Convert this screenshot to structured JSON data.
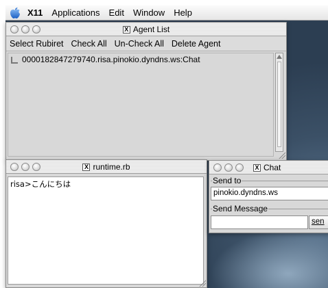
{
  "menubar": {
    "app_name": "X11",
    "items": [
      "Applications",
      "Edit",
      "Window",
      "Help"
    ]
  },
  "agent_window": {
    "title": "Agent List",
    "toolbar": [
      "Select Rubiret",
      "Check All",
      "Un-Check All",
      "Delete Agent"
    ],
    "agents": [
      "0000182847279740.risa.pinokio.dyndns.ws:Chat"
    ]
  },
  "runtime_window": {
    "title": "runtime.rb",
    "output": "risa>こんにちは"
  },
  "chat_window": {
    "title": "Chat",
    "send_to_label": "Send to",
    "send_to_value": "pinokio.dyndns.ws",
    "message_label": "Send Message",
    "message_value": "",
    "send_button": "sen"
  }
}
